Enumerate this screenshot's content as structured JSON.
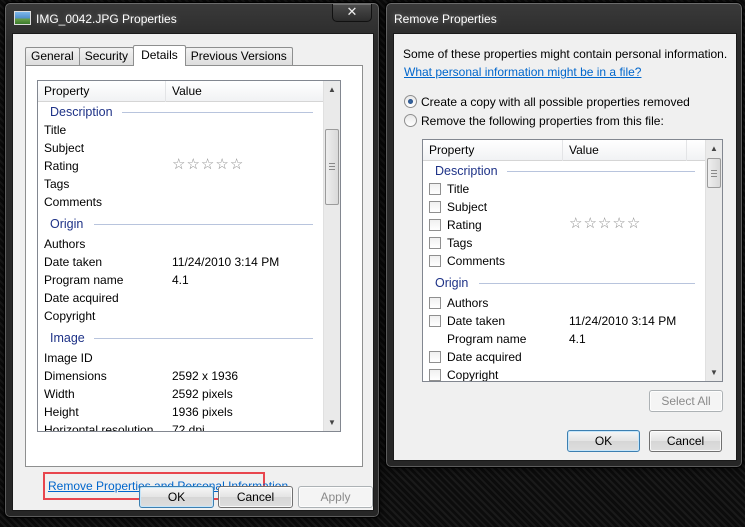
{
  "properties_window": {
    "title": "IMG_0042.JPG Properties",
    "close_glyph": "✕",
    "tabs": [
      "General",
      "Security",
      "Details",
      "Previous Versions"
    ],
    "active_tab": "Details",
    "columns": {
      "property": "Property",
      "value": "Value"
    },
    "groups": {
      "description": "Description",
      "origin": "Origin",
      "image": "Image"
    },
    "rows": {
      "title": "Title",
      "subject": "Subject",
      "rating": "Rating",
      "tags": "Tags",
      "comments": "Comments",
      "authors": "Authors",
      "date_taken": "Date taken",
      "date_taken_value": "11/24/2010 3:14 PM",
      "program_name": "Program name",
      "program_name_value": "4.1",
      "date_acquired": "Date acquired",
      "copyright": "Copyright",
      "image_id": "Image ID",
      "dimensions": "Dimensions",
      "dimensions_value": "2592 x 1936",
      "width": "Width",
      "width_value": "2592 pixels",
      "height": "Height",
      "height_value": "1936 pixels",
      "horizontal_resolution": "Horizontal resolution",
      "horizontal_resolution_value": "72 dpi"
    },
    "star_glyph": "☆",
    "rating_stars": 0,
    "remove_link": "Remove Properties and Personal Information",
    "buttons": {
      "ok": "OK",
      "cancel": "Cancel",
      "apply": "Apply"
    },
    "highlight_color": "#e8464e"
  },
  "remove_window": {
    "title": "Remove Properties",
    "intro": "Some of these properties might contain personal information.",
    "info_link": "What personal information might be in a file?",
    "option_copy": "Create a copy with all possible properties removed",
    "option_remove": "Remove the following properties from this file:",
    "selected_option": "copy",
    "columns": {
      "property": "Property",
      "value": "Value"
    },
    "groups": {
      "description": "Description",
      "origin": "Origin"
    },
    "rows": {
      "title": "Title",
      "subject": "Subject",
      "rating": "Rating",
      "tags": "Tags",
      "comments": "Comments",
      "authors": "Authors",
      "date_taken": "Date taken",
      "date_taken_value": "11/24/2010 3:14 PM",
      "program_name": "Program name",
      "program_name_value": "4.1",
      "date_acquired": "Date acquired",
      "copyright": "Copyright"
    },
    "buttons": {
      "select_all": "Select All",
      "ok": "OK",
      "cancel": "Cancel"
    }
  },
  "icons": {
    "scroll_up": "▲",
    "scroll_down": "▼"
  }
}
